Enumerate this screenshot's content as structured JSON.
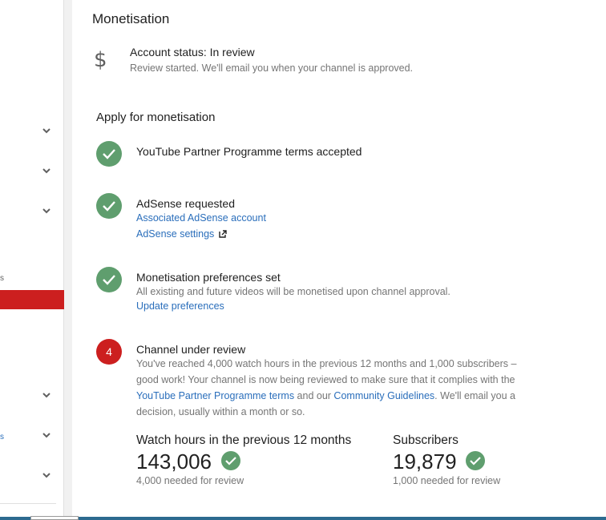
{
  "sidebar": {
    "partial_text_1": "s",
    "partial_text_2": "s"
  },
  "monetisation": {
    "title": "Monetisation",
    "dollar_symbol": "$",
    "account_status": "Account status: In review",
    "account_sub": "Review started. We'll email you when your channel is approved."
  },
  "apply": {
    "heading": "Apply for monetisation",
    "steps": [
      {
        "title": "YouTube Partner Programme terms accepted"
      },
      {
        "title": "AdSense requested",
        "link1": "Associated AdSense account",
        "link2": "AdSense settings"
      },
      {
        "title": "Monetisation preferences set",
        "sub": "All existing and future videos will be monetised upon channel approval.",
        "link1": "Update preferences"
      },
      {
        "number": "4",
        "title": "Channel under review",
        "text_a": "You've reached 4,000 watch hours in the previous 12 months and 1,000 subscribers – good work! Your channel is now being reviewed to make sure that it complies with the ",
        "link_terms": "YouTube Partner Programme terms",
        "text_b": " and our ",
        "link_guidelines": "Community Guidelines",
        "text_c": ". We'll email you a decision, usually within a month or so."
      }
    ]
  },
  "stats": {
    "watch_hours": {
      "label": "Watch hours in the previous 12 months",
      "value": "143,006",
      "needed": "4,000 needed for review"
    },
    "subscribers": {
      "label": "Subscribers",
      "value": "19,879",
      "needed": "1,000 needed for review"
    }
  },
  "colors": {
    "green": "#5f9e6e",
    "red": "#cc1f1f",
    "link": "#2a6ebb"
  }
}
